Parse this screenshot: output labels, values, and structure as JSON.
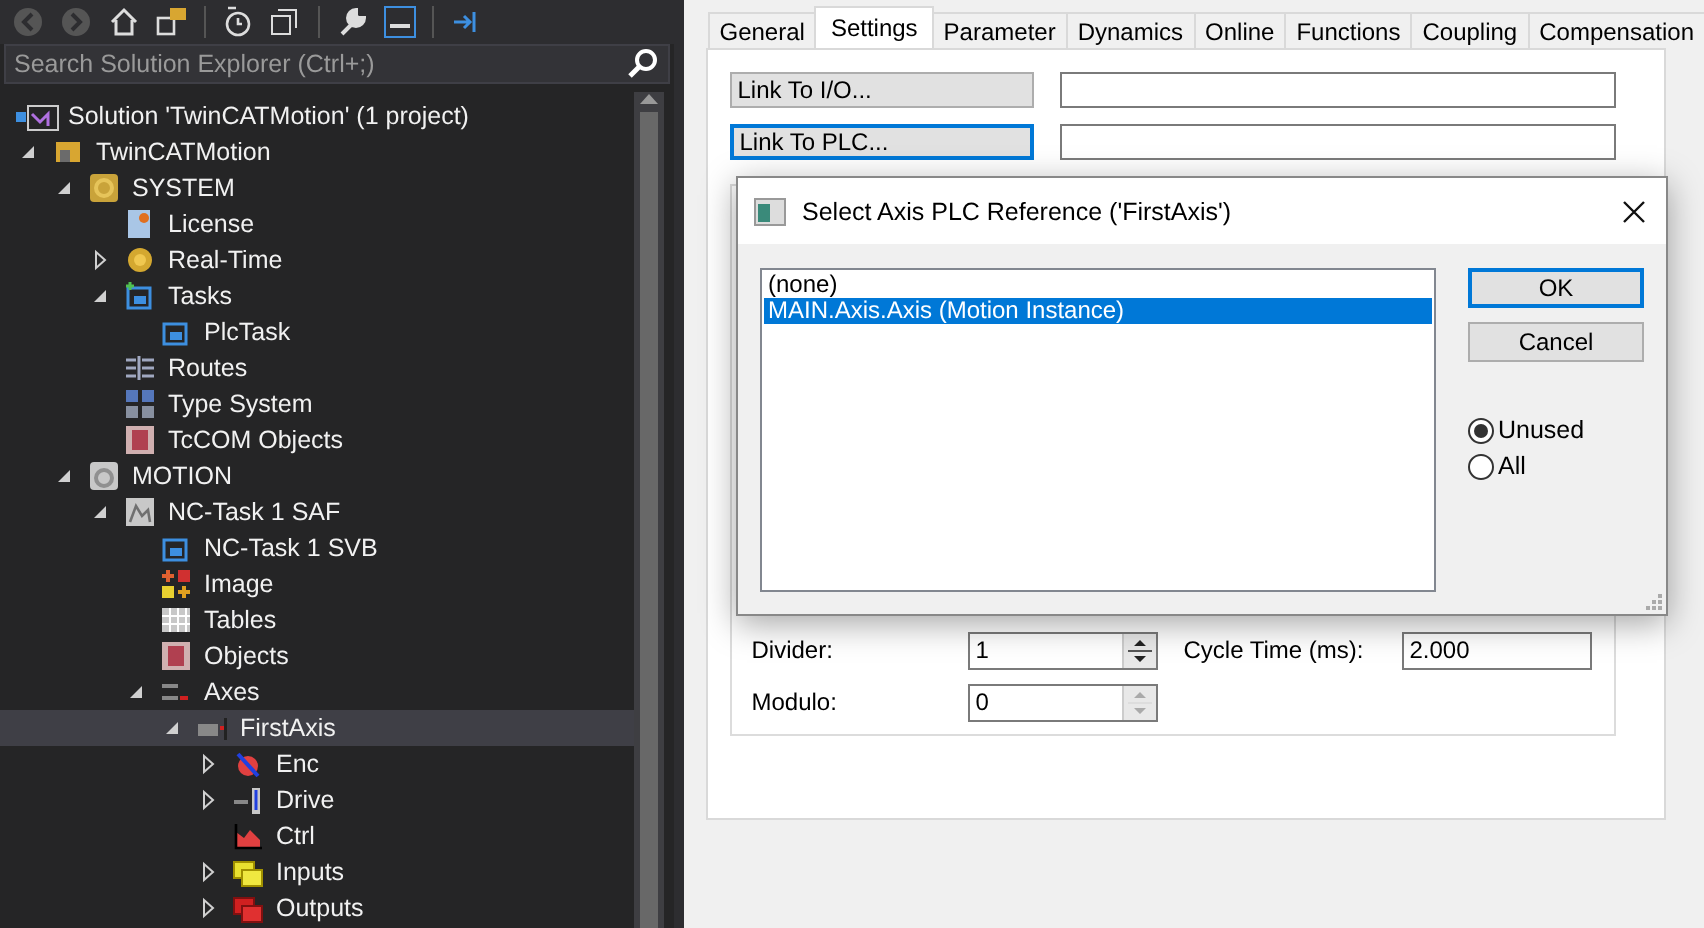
{
  "explorer": {
    "search": {
      "placeholder": "Search Solution Explorer (Ctrl+;)"
    },
    "solution": {
      "label": "Solution 'TwinCATMotion' (1 project)",
      "selected": false
    },
    "tree": [
      {
        "label": "TwinCATMotion",
        "selected": false,
        "expanded": true,
        "children": [
          {
            "label": "SYSTEM",
            "selected": false,
            "expanded": true,
            "children": [
              {
                "label": "License",
                "selected": false
              },
              {
                "label": "Real-Time",
                "selected": false,
                "expanded": false
              },
              {
                "label": "Tasks",
                "selected": false,
                "expanded": true,
                "children": [
                  {
                    "label": "PlcTask",
                    "selected": false
                  }
                ]
              },
              {
                "label": "Routes",
                "selected": false
              },
              {
                "label": "Type System",
                "selected": false
              },
              {
                "label": "TcCOM Objects",
                "selected": false
              }
            ]
          },
          {
            "label": "MOTION",
            "selected": false,
            "expanded": true,
            "children": [
              {
                "label": "NC-Task 1 SAF",
                "selected": false,
                "expanded": true,
                "children": [
                  {
                    "label": "NC-Task 1 SVB",
                    "selected": false
                  },
                  {
                    "label": "Image",
                    "selected": false
                  },
                  {
                    "label": "Tables",
                    "selected": false
                  },
                  {
                    "label": "Objects",
                    "selected": false
                  },
                  {
                    "label": "Axes",
                    "selected": false,
                    "expanded": true,
                    "children": [
                      {
                        "label": "FirstAxis",
                        "selected": true,
                        "expanded": true,
                        "children": [
                          {
                            "label": "Enc",
                            "selected": false,
                            "expanded": false
                          },
                          {
                            "label": "Drive",
                            "selected": false,
                            "expanded": false
                          },
                          {
                            "label": "Ctrl",
                            "selected": false
                          },
                          {
                            "label": "Inputs",
                            "selected": false,
                            "expanded": false
                          },
                          {
                            "label": "Outputs",
                            "selected": false,
                            "expanded": false
                          }
                        ]
                      }
                    ]
                  }
                ]
              }
            ]
          }
        ]
      }
    ]
  },
  "panel": {
    "tabs": [
      {
        "label": "General",
        "selected": false
      },
      {
        "label": "Settings",
        "selected": true
      },
      {
        "label": "Parameter",
        "selected": false
      },
      {
        "label": "Dynamics",
        "selected": false
      },
      {
        "label": "Online",
        "selected": false
      },
      {
        "label": "Functions",
        "selected": false
      },
      {
        "label": "Coupling",
        "selected": false
      },
      {
        "label": "Compensation",
        "selected": false
      }
    ],
    "links": [
      {
        "label": "Link To I/O...",
        "focused": false
      },
      {
        "label": "Link To PLC...",
        "focused": true
      }
    ],
    "divider": {
      "label": "Divider:",
      "value": "1",
      "spinner_enabled": true
    },
    "cycle_time": {
      "label": "Cycle Time (ms):",
      "value": "2.000"
    },
    "modulo": {
      "label": "Modulo:",
      "value": "0",
      "spinner_enabled": false
    }
  },
  "dialog": {
    "title": "Select Axis PLC Reference ('FirstAxis')",
    "items": [
      {
        "label": "(none)",
        "selected": false
      },
      {
        "label": "MAIN.Axis.Axis (Motion Instance)",
        "selected": true
      }
    ],
    "buttons": [
      {
        "label": "OK",
        "default": true
      },
      {
        "label": "Cancel",
        "default": false
      }
    ],
    "options": [
      {
        "label": "Unused",
        "selected": true
      },
      {
        "label": "All",
        "selected": false
      }
    ]
  }
}
